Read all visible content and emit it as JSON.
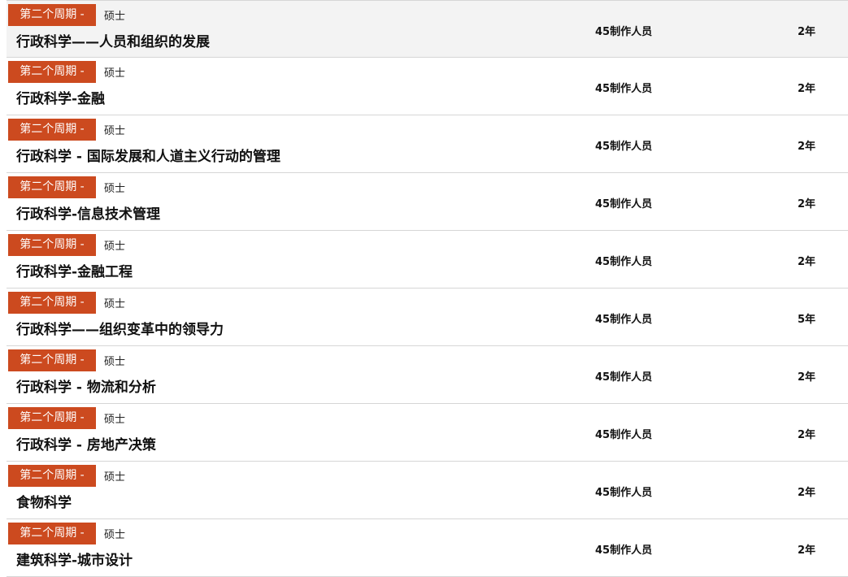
{
  "colors": {
    "badge_background": "#cc4a1f",
    "badge_text": "#ffffff",
    "row_highlight": "#f3f3f3",
    "divider": "#d6d6d6"
  },
  "programs": [
    {
      "cycle_label": "第二个周期 -",
      "degree": "硕士",
      "name": "行政科学——人员和组织的发展",
      "format": "45制作人员",
      "duration": "2年",
      "highlighted": true
    },
    {
      "cycle_label": "第二个周期 -",
      "degree": "硕士",
      "name": "行政科学-金融",
      "format": "45制作人员",
      "duration": "2年"
    },
    {
      "cycle_label": "第二个周期 -",
      "degree": "硕士",
      "name": "行政科学 - 国际发展和人道主义行动的管理",
      "format": "45制作人员",
      "duration": "2年"
    },
    {
      "cycle_label": "第二个周期 -",
      "degree": "硕士",
      "name": "行政科学-信息技术管理",
      "format": "45制作人员",
      "duration": "2年"
    },
    {
      "cycle_label": "第二个周期 -",
      "degree": "硕士",
      "name": "行政科学-金融工程",
      "format": "45制作人员",
      "duration": "2年"
    },
    {
      "cycle_label": "第二个周期 -",
      "degree": "硕士",
      "name": "行政科学——组织变革中的领导力",
      "format": "45制作人员",
      "duration": "5年"
    },
    {
      "cycle_label": "第二个周期 -",
      "degree": "硕士",
      "name": "行政科学 - 物流和分析",
      "format": "45制作人员",
      "duration": "2年"
    },
    {
      "cycle_label": "第二个周期 -",
      "degree": "硕士",
      "name": "行政科学 - 房地产决策",
      "format": "45制作人员",
      "duration": "2年"
    },
    {
      "cycle_label": "第二个周期 -",
      "degree": "硕士",
      "name": "食物科学",
      "format": "45制作人员",
      "duration": "2年"
    },
    {
      "cycle_label": "第二个周期 -",
      "degree": "硕士",
      "name": "建筑科学-城市设计",
      "format": "45制作人员",
      "duration": "2年"
    }
  ]
}
